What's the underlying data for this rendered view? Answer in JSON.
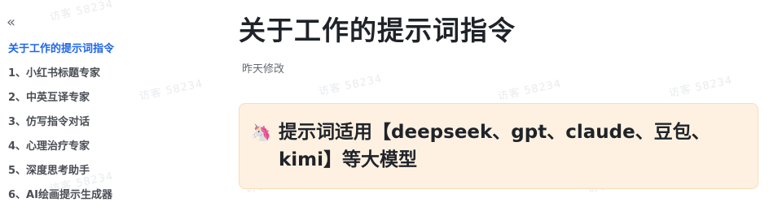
{
  "sidebar": {
    "collapse_icon": "double-chevron-left-icon",
    "collapse_glyph": "«",
    "toc": [
      "关于工作的提示词指令",
      "1、小红书标题专家",
      "2、中英互译专家",
      "3、仿写指令对话",
      "4、心理治疗专家",
      "5、深度思考助手",
      "6、AI绘画提示生成器"
    ],
    "active_index": 0
  },
  "main": {
    "title": "关于工作的提示词指令",
    "modified": "昨天修改",
    "callout": {
      "icon": "unicorn-icon",
      "icon_glyph": "🦄",
      "text": "提示词适用【deepseek、gpt、claude、豆包、kimi】等大模型"
    }
  },
  "watermark": {
    "text": "访客 58234"
  },
  "colors": {
    "accent": "#1f66e8",
    "callout_bg": "#fef1e1",
    "callout_border": "#f8dcb8"
  }
}
